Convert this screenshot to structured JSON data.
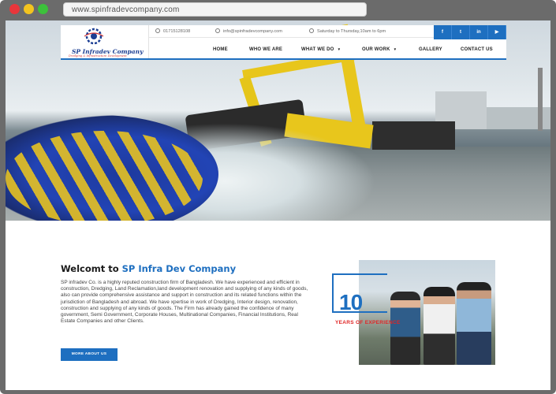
{
  "browser": {
    "url": "www.spinfradevcompany.com"
  },
  "brand": {
    "primary_color": "#1e6fc0",
    "accent_red": "#e02626",
    "logo_name": "SP Infradev Company",
    "logo_tagline": "Dredging & Infrastructure Development"
  },
  "topbar": {
    "phone": "01715128108",
    "email": "info@spinfradevcompany.com",
    "hours": "Saturday to Thursday,10am to 6pm",
    "social": [
      {
        "icon": "facebook-icon",
        "label": "f"
      },
      {
        "icon": "twitter-icon",
        "label": "t"
      },
      {
        "icon": "linkedin-icon",
        "label": "in"
      },
      {
        "icon": "youtube-icon",
        "label": "▶"
      }
    ]
  },
  "nav": {
    "items": [
      {
        "label": "HOME",
        "dropdown": false
      },
      {
        "label": "WHO WE ARE",
        "dropdown": false
      },
      {
        "label": "WHAT WE DO",
        "dropdown": true
      },
      {
        "label": "OUR WORK",
        "dropdown": true
      },
      {
        "label": "GALLERY",
        "dropdown": false
      },
      {
        "label": "CONTACT US",
        "dropdown": false
      }
    ]
  },
  "welcome": {
    "heading_prefix": "Welcomt to ",
    "heading_company": "SP Infra Dev Company",
    "body": "SP infradev Co. is a highly reputed construction firm of Bangladesh. We have experienced and efficient in construction, Dredging, Land Reclamation,land development renovation and supplying of any kinds of goods, also can provide comprehensive assistance and support in construction and its related functions within the jurisdiction of Bangladesh and abroad. We have xpertise in work of Dredging, Interior design, renovation, construction and supplying of any kinds of goods. The Firm has already gained the confidence of many government, Semi Government, Corporate Houses, Multinational Companies, Financial Institutions, Real Estate Companies and other Clients.",
    "button_label": "MORE ABOUT US"
  },
  "experience": {
    "years": "10",
    "label": "YEARS OF EXPERIENCE"
  }
}
